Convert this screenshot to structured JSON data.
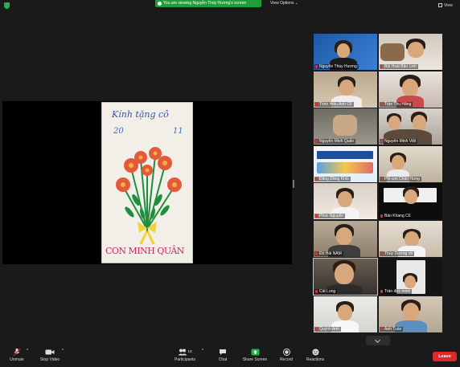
{
  "topbar": {
    "banner_text": "You are viewing Nguyễn Thùy Hương's screen",
    "view_options": "View Options ⌄",
    "view_label": "View"
  },
  "shared_card": {
    "line1": "Kính tặng cô",
    "num_left": "20",
    "num_right": "11",
    "signature": "CON MINH QUÂN"
  },
  "participants": [
    "Nguyễn Thùy Hương",
    "Bùi Hoài Bảo Linh",
    "Trịnh Hiếu Anh C6",
    "Trần Thu Hằng",
    "Nguyễn Minh Quân",
    "Nguyễn Minh Việt",
    "Đặng Đăng Khôi",
    "Phi con Chấn Hưng",
    "Phúc Nguyên",
    "Bảo Khang C6",
    "Đỗ Hải NAM",
    "Thùy Dương nh",
    "Cát Long",
    "Trần đức minh",
    "Quỳnh Anh",
    "Anh Tuấn"
  ],
  "toolbar": {
    "unmute": "Unmute",
    "stop_video": "Stop Video",
    "participants": "Participants",
    "participants_count": "19",
    "chat": "Chat",
    "share_screen": "Share Screen",
    "record": "Record",
    "reactions": "Reactions",
    "leave": "Leave"
  },
  "colors": {
    "banner_green": "#1e9e3a",
    "leave_red": "#e02828",
    "active_speaker": "#e5d22a",
    "share_green": "#22b14c"
  }
}
